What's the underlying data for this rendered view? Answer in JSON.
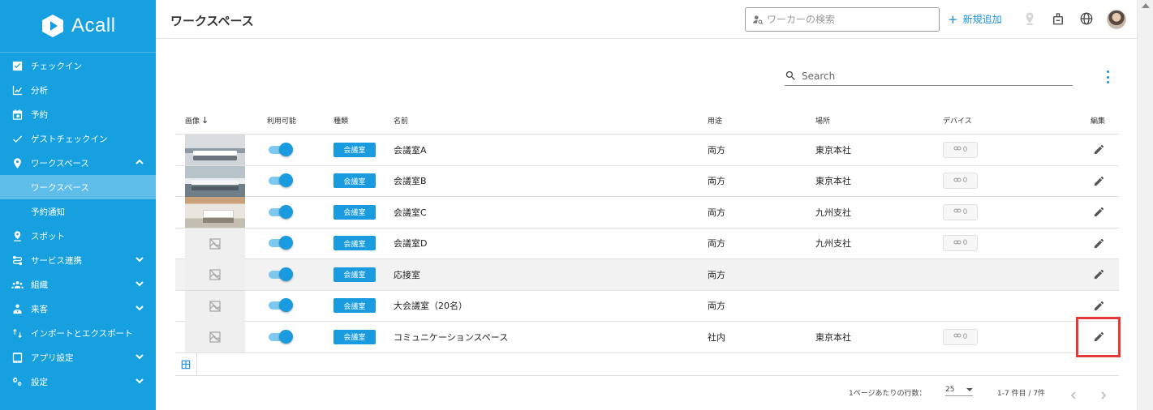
{
  "app": {
    "brand": "Acall"
  },
  "sidebar": {
    "items": [
      {
        "label": "チェックイン",
        "icon": "checkbox-icon"
      },
      {
        "label": "分析",
        "icon": "chart-icon"
      },
      {
        "label": "予約",
        "icon": "calendar-icon"
      },
      {
        "label": "ゲストチェックイン",
        "icon": "check-icon"
      },
      {
        "label": "ワークスペース",
        "icon": "pin-icon"
      },
      {
        "label": "ワークスペース",
        "sub": true
      },
      {
        "label": "予約通知",
        "sub": true
      },
      {
        "label": "スポット",
        "icon": "spot-pin-icon"
      },
      {
        "label": "サービス連携",
        "icon": "route-icon"
      },
      {
        "label": "組織",
        "icon": "group-icon"
      },
      {
        "label": "来客",
        "icon": "visitor-icon"
      },
      {
        "label": "インポートとエクスポート",
        "icon": "import-export-icon"
      },
      {
        "label": "アプリ設定",
        "icon": "tablet-icon"
      },
      {
        "label": "設定",
        "icon": "gears-icon"
      }
    ]
  },
  "header": {
    "title": "ワークスペース",
    "worker_search_placeholder": "ワーカーの検索",
    "add_new_label": "新規追加"
  },
  "table": {
    "search_placeholder": "Search",
    "columns": {
      "image": "画像",
      "available": "利用可能",
      "type": "種類",
      "name": "名前",
      "usage": "用途",
      "location": "場所",
      "device": "デバイス",
      "edit": "編集"
    },
    "rows": [
      {
        "photo": "p1",
        "available": true,
        "type": "会議室",
        "name": "会議室A",
        "usage": "両方",
        "location": "東京本社",
        "device": "0"
      },
      {
        "photo": "p2",
        "available": true,
        "type": "会議室",
        "name": "会議室B",
        "usage": "両方",
        "location": "東京本社",
        "device": "0"
      },
      {
        "photo": "p3",
        "available": true,
        "type": "会議室",
        "name": "会議室C",
        "usage": "両方",
        "location": "九州支社",
        "device": "0"
      },
      {
        "photo": "",
        "available": true,
        "type": "会議室",
        "name": "会議室D",
        "usage": "両方",
        "location": "九州支社",
        "device": "0"
      },
      {
        "photo": "",
        "available": true,
        "type": "会議室",
        "name": "応接室",
        "usage": "両方",
        "location": "",
        "device": "",
        "highlighted": true
      },
      {
        "photo": "",
        "available": true,
        "type": "会議室",
        "name": "大会議室（20名）",
        "usage": "両方",
        "location": "",
        "device": ""
      },
      {
        "photo": "",
        "available": true,
        "type": "会議室",
        "name": "コミュニケーションスペース",
        "usage": "社内",
        "location": "東京本社",
        "device": "0"
      }
    ]
  },
  "pagination": {
    "rows_per_page_label": "1ページあたりの行数：",
    "rows_per_page": "25",
    "range": "1-7 件目 / 7件"
  },
  "colors": {
    "sidebar": "#16a0e0",
    "accent": "#1a9be0",
    "highlight": "#e53935"
  }
}
